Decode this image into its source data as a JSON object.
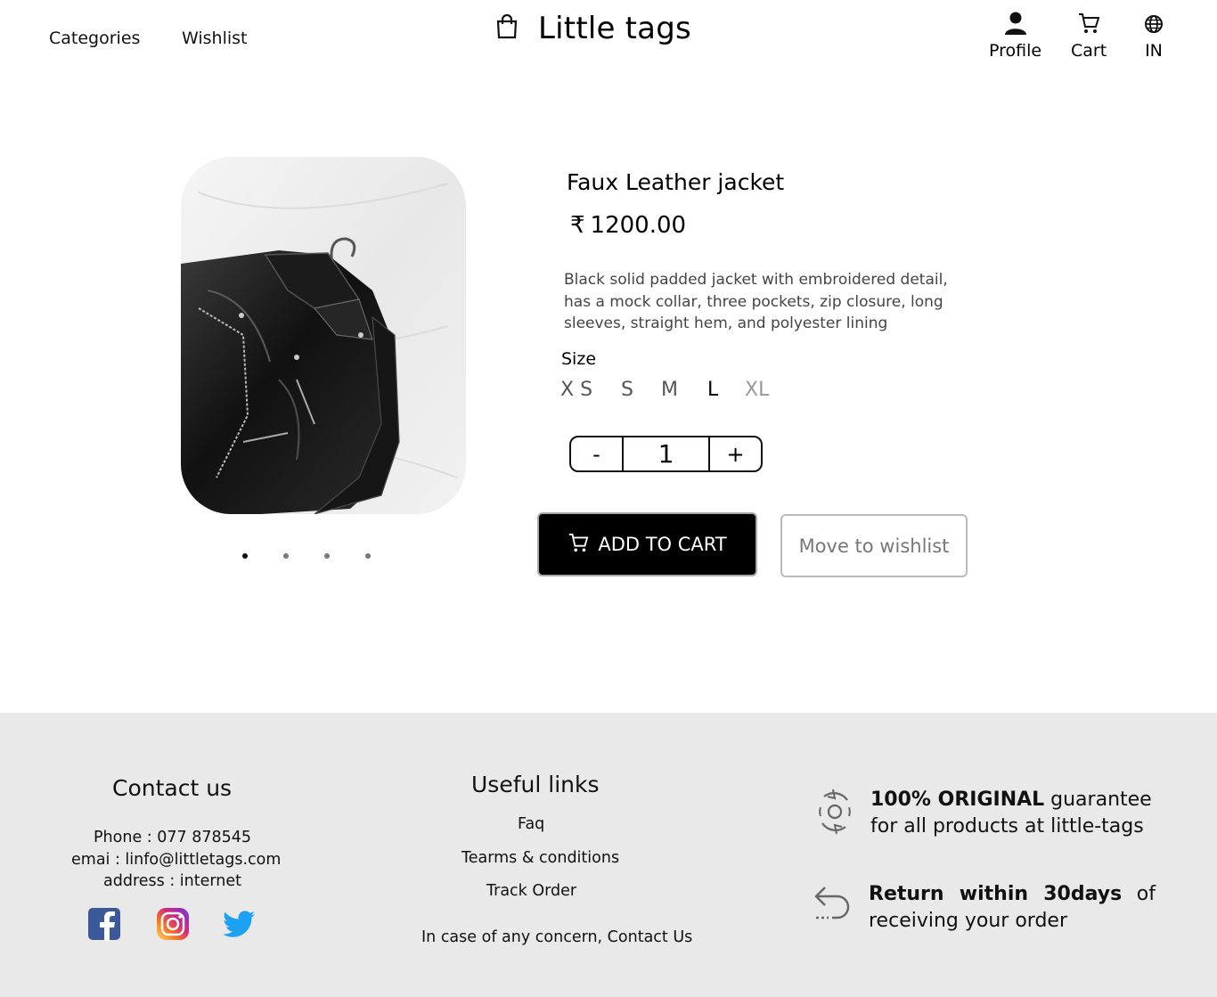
{
  "header": {
    "nav": [
      "Categories",
      "Wishlist"
    ],
    "brand": "Little tags",
    "actions": {
      "profile": "Profile",
      "cart": "Cart",
      "region": "IN"
    }
  },
  "product": {
    "image_icon": "leather-jacket-photo",
    "carousel": {
      "count": 4,
      "active_index": 0
    },
    "name": "Faux Leather jacket",
    "currency_symbol": "₹",
    "price": "1200.00",
    "description": "Black solid padded jacket with embroidered detail, has a mock collar, three pockets, zip closure, long sleeves, straight hem, and polyester lining",
    "size_label": "Size",
    "sizes": [
      {
        "label": "X S",
        "state": "available"
      },
      {
        "label": "S",
        "state": "available"
      },
      {
        "label": "M",
        "state": "available"
      },
      {
        "label": "L",
        "state": "selected"
      },
      {
        "label": "XL",
        "state": "unavailable"
      }
    ],
    "quantity": {
      "minus": "-",
      "value": "1",
      "plus": "+"
    },
    "add_to_cart": "ADD TO CART",
    "move_to_wishlist": "Move to wishlist"
  },
  "footer": {
    "contact": {
      "title": "Contact us",
      "phone": "Phone  : 077 878545",
      "email": "emai : linfo@littletags.com",
      "address": "address : internet",
      "socials": [
        "facebook-icon",
        "instagram-icon",
        "twitter-icon"
      ]
    },
    "links": {
      "title": "Useful links",
      "items": [
        "Faq",
        "Tearms & conditions",
        "Track Order"
      ],
      "note": "In case of any concern, Contact Us"
    },
    "guarantees": [
      {
        "bold": "100% ORIGINAL",
        "rest": " guarantee for all products at little-tags",
        "icon": "original-badge-icon"
      },
      {
        "bold": "Return within 30days",
        "rest": " of receiving your order",
        "icon": "return-arrow-icon"
      }
    ]
  },
  "colors": {
    "accent": "#000000",
    "footer_bg": "#e9e9e9",
    "facebook": "#3b5998",
    "twitter": "#1da1f2"
  }
}
